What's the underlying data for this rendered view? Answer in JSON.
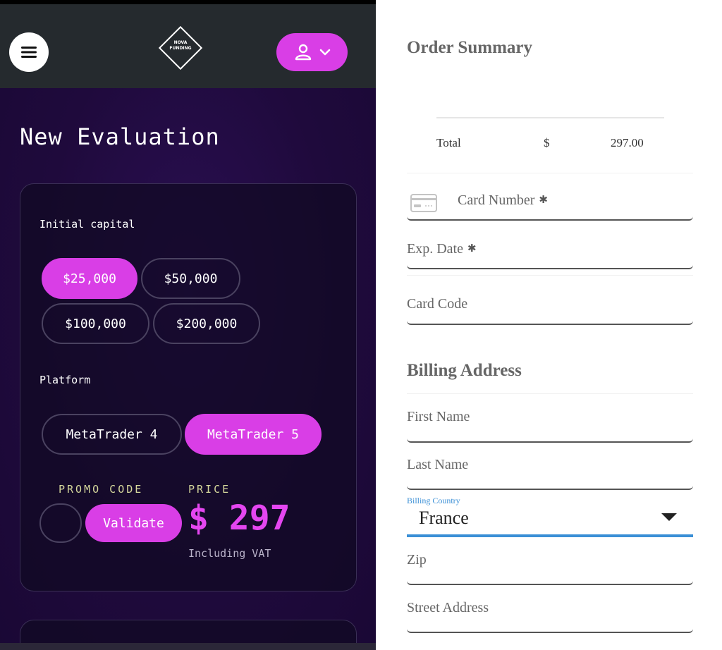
{
  "header": {
    "logo_line1": "NOVA",
    "logo_line2": "FUNDING"
  },
  "page": {
    "title": "New Evaluation"
  },
  "capital": {
    "label": "Initial capital",
    "options": [
      "$25,000",
      "$50,000",
      "$100,000",
      "$200,000"
    ],
    "selected": "$25,000"
  },
  "platform": {
    "label": "Platform",
    "options": [
      "MetaTrader 4",
      "MetaTrader 5"
    ],
    "selected": "MetaTrader 5"
  },
  "promo": {
    "label": "PROMO CODE",
    "validate_label": "Validate"
  },
  "price": {
    "label": "PRICE",
    "value": "$ 297",
    "note": "Including VAT"
  },
  "colors": {
    "accent": "#d93ee6",
    "header_bg": "#252a2e",
    "panel_bg": "#1f0a3c",
    "focus_blue": "#3a8fd6"
  },
  "order_summary": {
    "title": "Order Summary",
    "total_label": "Total",
    "currency": "$",
    "total_amount": "297.00"
  },
  "payment": {
    "card_number": "Card Number",
    "exp_date": "Exp. Date",
    "card_code": "Card Code",
    "required_mark": "✱"
  },
  "billing": {
    "title": "Billing Address",
    "first_name": "First Name",
    "last_name": "Last Name",
    "country_label": "Billing Country",
    "country_value": "France",
    "zip": "Zip",
    "street": "Street Address"
  }
}
